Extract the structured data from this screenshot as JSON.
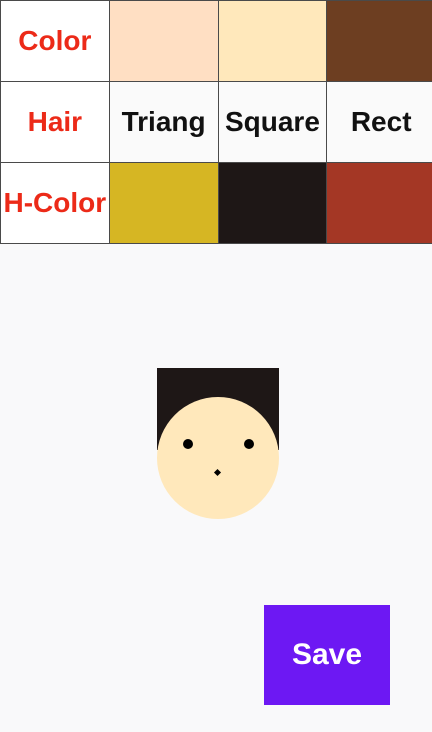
{
  "rows": {
    "color": {
      "label": "Color",
      "options": [
        "#ffdfc3",
        "#ffe8bb",
        "#6d3e21"
      ]
    },
    "hair": {
      "label": "Hair",
      "options": [
        "Triang",
        "Square",
        "Rect"
      ]
    },
    "hair_color": {
      "label": "H-Color",
      "options": [
        "#d6b623",
        "#1e1716",
        "#a43725"
      ]
    }
  },
  "avatar": {
    "face_color": "#ffe8bb",
    "hair_color": "#1e1716",
    "hair_style": "Square"
  },
  "save_button": {
    "label": "Save",
    "color": "#6d18f3"
  },
  "colors": {
    "label_text": "#ec2a18",
    "background": "#f9f9fa"
  }
}
